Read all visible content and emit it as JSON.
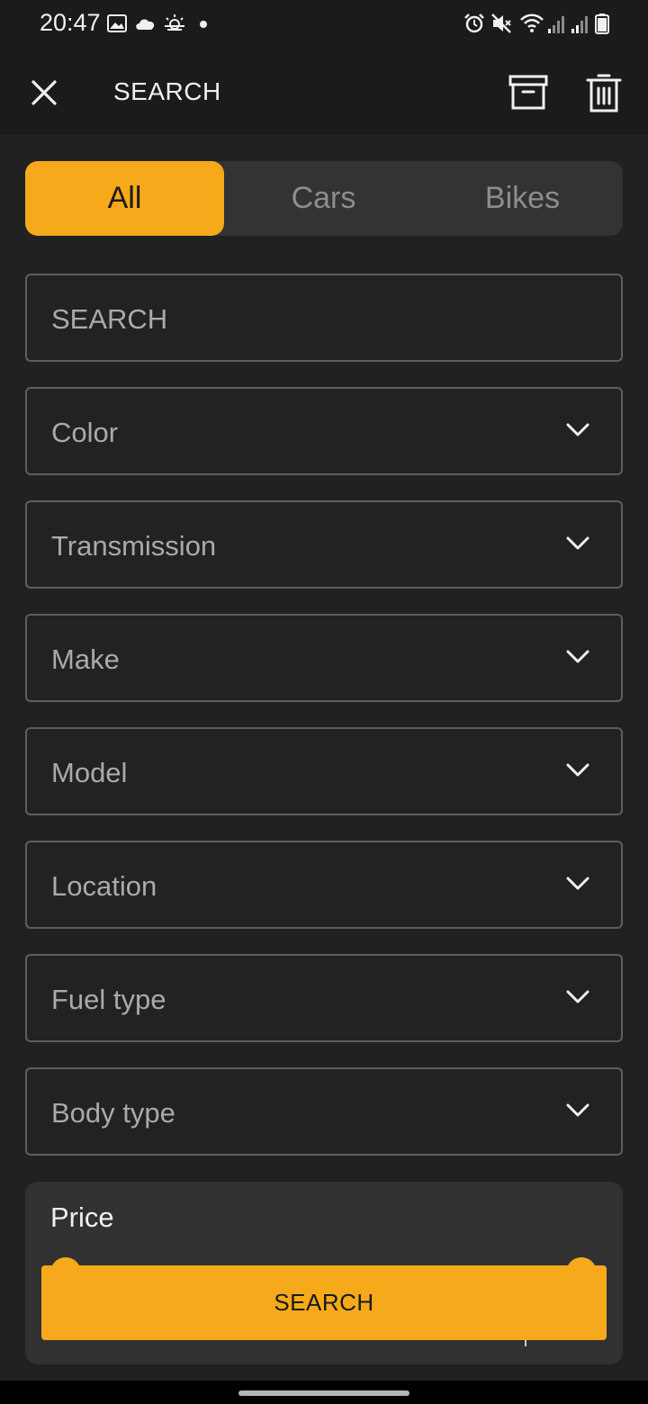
{
  "status_bar": {
    "time": "20:47",
    "left_icons": [
      "image-icon",
      "cloud-icon",
      "weather-icon",
      "dot-icon"
    ],
    "right_icons": [
      "alarm-icon",
      "mute-icon",
      "wifi-icon",
      "signal-icon",
      "signal-icon",
      "battery-icon"
    ]
  },
  "appbar": {
    "title": "SEARCH",
    "close_icon": "close-icon",
    "archive_icon": "archive-icon",
    "delete_icon": "trash-icon"
  },
  "tabs": [
    {
      "label": "All",
      "active": true
    },
    {
      "label": "Cars",
      "active": false
    },
    {
      "label": "Bikes",
      "active": false
    }
  ],
  "search_field": {
    "placeholder": "SEARCH"
  },
  "filters": [
    {
      "label": "Color"
    },
    {
      "label": "Transmission"
    },
    {
      "label": "Make"
    },
    {
      "label": "Model"
    },
    {
      "label": "Location"
    },
    {
      "label": "Fuel type"
    },
    {
      "label": "Body type"
    }
  ],
  "price": {
    "label": "Price"
  },
  "search_button": {
    "label": "SEARCH"
  },
  "colors": {
    "accent": "#f6a91a",
    "background": "#212121",
    "field_border": "#5e5e5e"
  }
}
